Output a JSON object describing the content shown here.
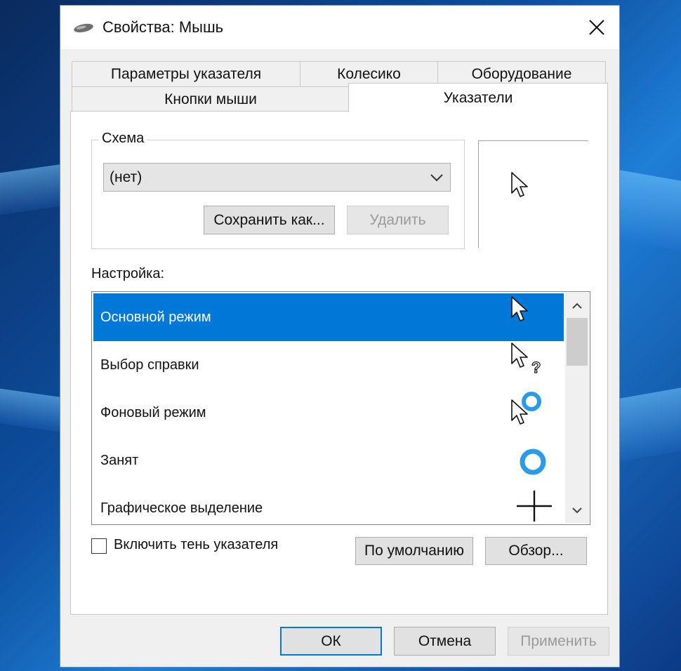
{
  "window": {
    "title": "Свойства: Мышь"
  },
  "tabs": {
    "row1": [
      "Параметры указателя",
      "Колесико",
      "Оборудование"
    ],
    "row2": [
      "Кнопки мыши",
      "Указатели"
    ],
    "active": "Указатели"
  },
  "scheme": {
    "label": "Схема",
    "selected": "(нет)",
    "save_as": "Сохранить как...",
    "delete": "Удалить"
  },
  "customize": {
    "label": "Настройка:",
    "items": [
      {
        "label": "Основной режим",
        "icon": "arrow-cursor-icon",
        "selected": true
      },
      {
        "label": "Выбор справки",
        "icon": "help-select-cursor-icon",
        "selected": false
      },
      {
        "label": "Фоновый режим",
        "icon": "working-in-background-cursor-icon",
        "selected": false
      },
      {
        "label": "Занят",
        "icon": "busy-cursor-icon",
        "selected": false
      },
      {
        "label": "Графическое выделение",
        "icon": "precision-select-cursor-icon",
        "selected": false
      }
    ]
  },
  "shadow": {
    "label": "Включить тень указателя",
    "checked": false
  },
  "buttons": {
    "use_default": "По умолчанию",
    "browse": "Обзор...",
    "ok": "ОК",
    "cancel": "Отмена",
    "apply": "Применить"
  },
  "colors": {
    "accent": "#0078d7",
    "busy_ring": "#2b9be8"
  }
}
